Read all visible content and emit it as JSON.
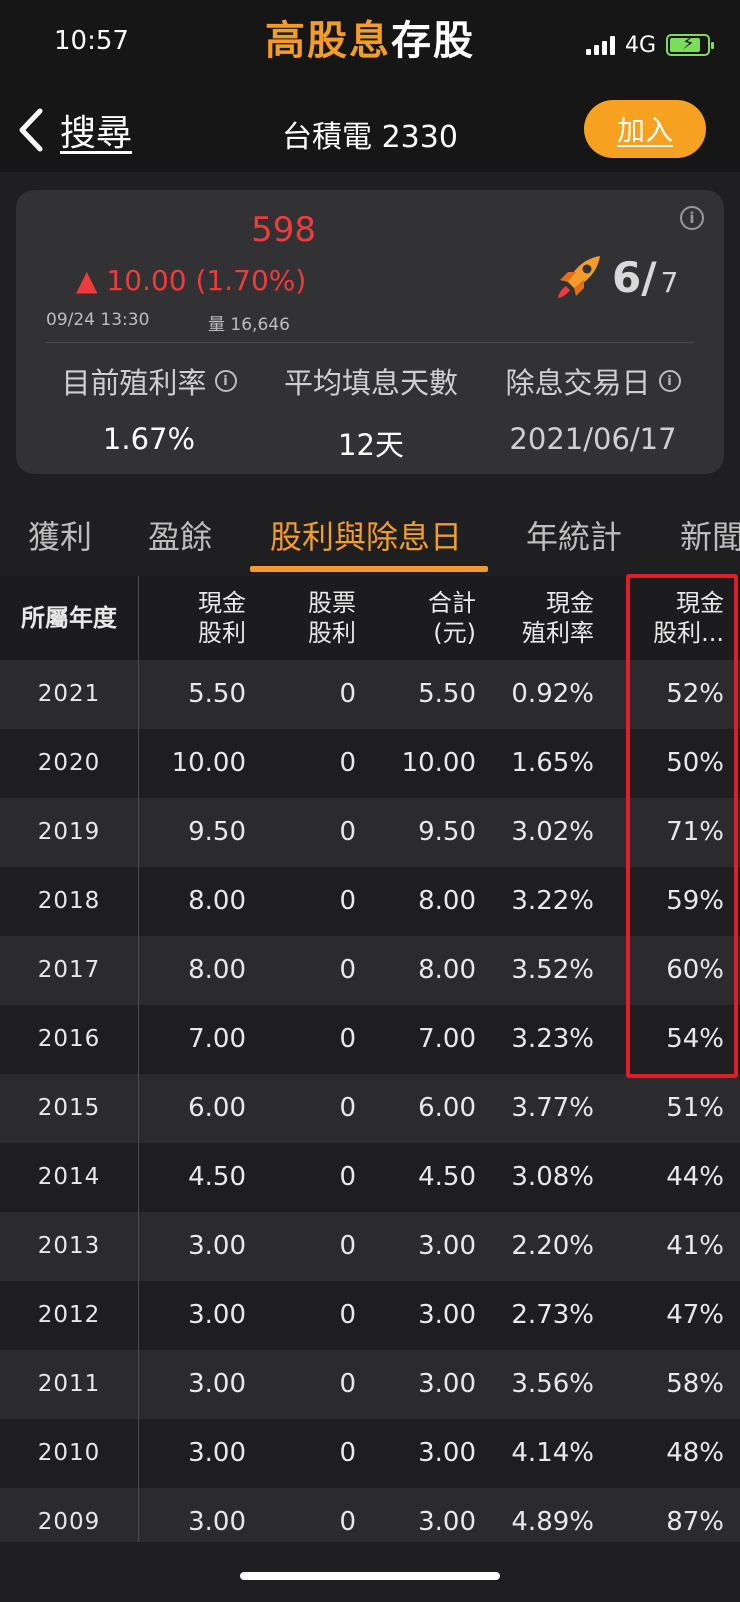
{
  "status_bar": {
    "time": "10:57",
    "network": "4G",
    "app_title_accent": "高股息",
    "app_title_rest": "存股"
  },
  "nav": {
    "back_label": "搜尋",
    "title": "台積電 2330",
    "add_label": "加入"
  },
  "quote": {
    "price": "598",
    "change": "▲ 10.00 (1.70%)",
    "time": "09/24 13:30",
    "volume": "量 16,646",
    "score_main": "6/",
    "score_total": "7",
    "metrics": [
      {
        "label": "目前殖利率",
        "value": "1.67%"
      },
      {
        "label": "平均填息天數",
        "value": "12天"
      },
      {
        "label": "除息交易日",
        "value": "2021/06/17"
      }
    ]
  },
  "tabs": [
    {
      "label": "獲利"
    },
    {
      "label": "盈餘"
    },
    {
      "label": "股利與除息日"
    },
    {
      "label": "年統計"
    },
    {
      "label": "新聞"
    }
  ],
  "active_tab": "股利與除息日",
  "table": {
    "headers": [
      [
        "所屬年度"
      ],
      [
        "現金",
        "股利"
      ],
      [
        "股票",
        "股利"
      ],
      [
        "合計",
        "(元)"
      ],
      [
        "現金",
        "殖利率"
      ],
      [
        "現金",
        "股利..."
      ]
    ],
    "rows": [
      [
        "2021",
        "5.50",
        "0",
        "5.50",
        "0.92%",
        "52%"
      ],
      [
        "2020",
        "10.00",
        "0",
        "10.00",
        "1.65%",
        "50%"
      ],
      [
        "2019",
        "9.50",
        "0",
        "9.50",
        "3.02%",
        "71%"
      ],
      [
        "2018",
        "8.00",
        "0",
        "8.00",
        "3.22%",
        "59%"
      ],
      [
        "2017",
        "8.00",
        "0",
        "8.00",
        "3.52%",
        "60%"
      ],
      [
        "2016",
        "7.00",
        "0",
        "7.00",
        "3.23%",
        "54%"
      ],
      [
        "2015",
        "6.00",
        "0",
        "6.00",
        "3.77%",
        "51%"
      ],
      [
        "2014",
        "4.50",
        "0",
        "4.50",
        "3.08%",
        "44%"
      ],
      [
        "2013",
        "3.00",
        "0",
        "3.00",
        "2.20%",
        "41%"
      ],
      [
        "2012",
        "3.00",
        "0",
        "3.00",
        "2.73%",
        "47%"
      ],
      [
        "2011",
        "3.00",
        "0",
        "3.00",
        "3.56%",
        "58%"
      ],
      [
        "2010",
        "3.00",
        "0",
        "3.00",
        "4.14%",
        "48%"
      ],
      [
        "2009",
        "3.00",
        "0",
        "3.00",
        "4.89%",
        "87%"
      ]
    ]
  },
  "colors": {
    "accent": "#f39c2a",
    "price_up": "#ef3b3b",
    "highlight": "#e11d2a"
  }
}
